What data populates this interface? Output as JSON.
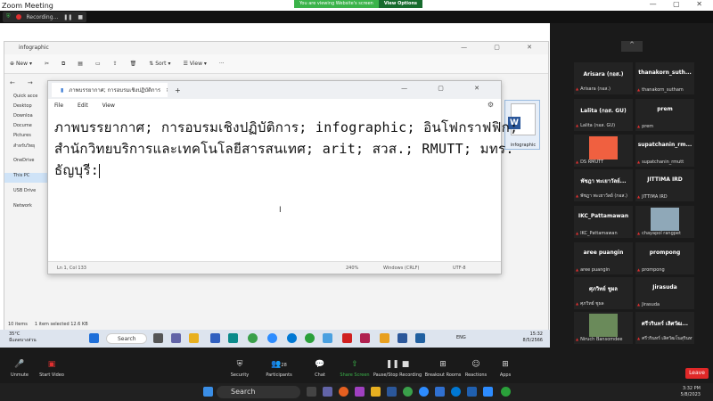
{
  "zoom": {
    "title": "Zoom Meeting",
    "viewing_notice": "You are viewing Website's screen",
    "view_options": "View Options",
    "recording": "Recording..."
  },
  "explorer": {
    "tab": "infographic",
    "new": "New",
    "sort": "Sort",
    "view": "View",
    "side": [
      "Quick acce",
      "Desktop",
      "Downloa",
      "Docume",
      "Pictures",
      "สำหรับวิทยุ",
      "OneDrive",
      "This PC",
      "USB Drive",
      "Network"
    ],
    "items": "10 items",
    "selected": "1 item selected  12.6 KB",
    "file_label": "infographic"
  },
  "notepad": {
    "tab": "ภาพบรรยากาศ; การอบรมเชิงปฏิบัติการ",
    "menu": [
      "File",
      "Edit",
      "View"
    ],
    "lines": [
      "ภาพบรรยากาศ; การอบรมเชิงปฏิบัติการ; infographic; อินโฟกราฟฟิก;",
      "สำนักวิทยบริการและเทคโนโลยีสารสนเทศ; arit; สวส.; RMUTT; มทร.",
      "ธัญบุรี:"
    ],
    "status": {
      "pos": "Ln 1, Col 133",
      "zoom": "240%",
      "eol": "Windows (CRLF)",
      "enc": "UTF-8"
    }
  },
  "shared_taskbar": {
    "weather_temp": "35°C",
    "weather_desc": "มีแดดบางส่วน",
    "search": "Search",
    "lang": "ENG",
    "time": "15:32",
    "date": "8/5/2566"
  },
  "participants": [
    {
      "name": "Arisara (กอส.)",
      "sub": "Arisara (กอส.)",
      "color": ""
    },
    {
      "name": "thanakorn_suth...",
      "sub": "thanakorn_sutham",
      "color": ""
    },
    {
      "name": "Lalita (กอส. GU)",
      "sub": "Lalita (กอส. GU)",
      "color": ""
    },
    {
      "name": "prem",
      "sub": "prem",
      "color": ""
    },
    {
      "name": "",
      "sub": "DS RMUTT",
      "color": "#f06040"
    },
    {
      "name": "supatchanin_rm...",
      "sub": "supatchanin_rmutt",
      "color": ""
    },
    {
      "name": "พัชฎา พะเยาวัลย์...",
      "sub": "พัชฎา พะเยาวัลย์ (กอส.)",
      "color": ""
    },
    {
      "name": "JITTIMA IRD",
      "sub": "JITTIMA IRD",
      "color": ""
    },
    {
      "name": "IKC_Pattamawan",
      "sub": "IKC_Pattamawan",
      "color": ""
    },
    {
      "name": "",
      "sub": "chayapol rangpet",
      "color": "#8fa8b8"
    },
    {
      "name": "aree puangin",
      "sub": "aree puangin",
      "color": ""
    },
    {
      "name": "prompong",
      "sub": "prompong",
      "color": ""
    },
    {
      "name": "ศุภวิทย์ ชูผล",
      "sub": "ศุภวิทย์ ชูผล",
      "color": ""
    },
    {
      "name": "Jirasuda",
      "sub": "Jirasuda",
      "color": ""
    },
    {
      "name": "",
      "sub": "Niruch Bansomdee",
      "color": "#6a8a5a"
    },
    {
      "name": "ศรีวรินทร์ เลิศวัฒ...",
      "sub": "ศรีวรินทร์ เลิศวัฒโนสุรินทร์",
      "color": ""
    }
  ],
  "controls": {
    "unmute": "Unmute",
    "start_video": "Start Video",
    "security": "Security",
    "participants": "Participants",
    "participants_count": "28",
    "chat": "Chat",
    "share": "Share Screen",
    "record": "Pause/Stop Recording",
    "breakout": "Breakout Rooms",
    "reactions": "Reactions",
    "apps": "Apps",
    "leave": "Leave"
  },
  "taskbar": {
    "search": "Search",
    "time": "3:32 PM",
    "date": "5/8/2023"
  }
}
